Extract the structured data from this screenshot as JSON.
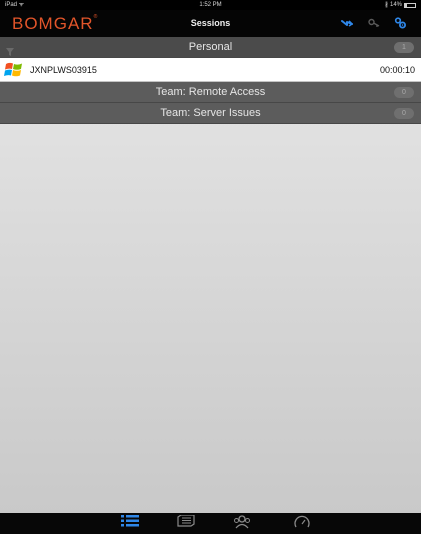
{
  "status_bar": {
    "carrier": "iPad ᯤ",
    "time": "1:52 PM",
    "battery": "14%"
  },
  "nav": {
    "logo": "BOMGAR",
    "title": "Sessions",
    "accent_color": "#2f87e8",
    "logo_color": "#e2552a",
    "icons": [
      "transfer-arrow-icon",
      "key-icon",
      "settings-gear-key-icon"
    ]
  },
  "groups": [
    {
      "name": "Personal",
      "count": "1"
    },
    {
      "name": "Team: Remote Access",
      "count": "0"
    },
    {
      "name": "Team: Server Issues",
      "count": "0"
    }
  ],
  "sessions": [
    {
      "name": "JXNPLWS03915",
      "elapsed": "00:00:10",
      "os_icon": "windows-logo-icon"
    }
  ],
  "tabs": [
    {
      "icon": "list-icon",
      "selected": true
    },
    {
      "icon": "server-icon",
      "selected": false
    },
    {
      "icon": "team-icon",
      "selected": false
    },
    {
      "icon": "dashboard-gauge-icon",
      "selected": false
    }
  ]
}
